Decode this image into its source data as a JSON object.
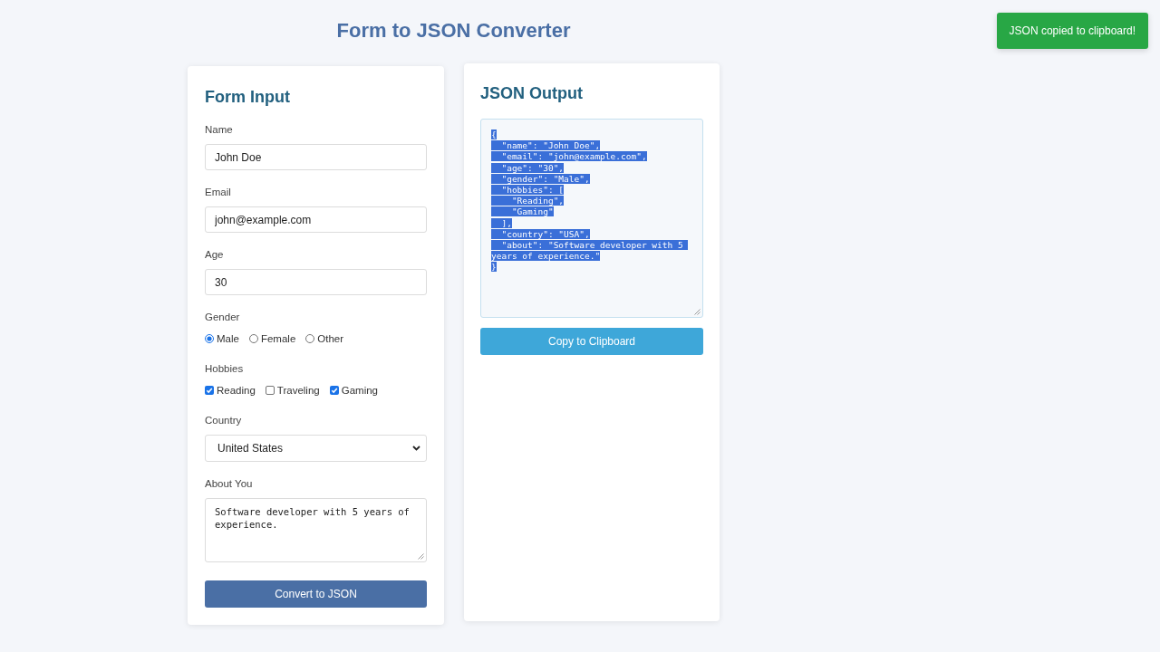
{
  "title": "Form to JSON Converter",
  "form": {
    "heading": "Form Input",
    "fields": [
      {
        "kind": "text",
        "label": "Name",
        "value": "John Doe"
      },
      {
        "kind": "text",
        "label": "Email",
        "value": "john@example.com"
      },
      {
        "kind": "text",
        "label": "Age",
        "value": "30"
      },
      {
        "kind": "radio",
        "label": "Gender",
        "options": [
          {
            "label": "Male",
            "selected": true
          },
          {
            "label": "Female",
            "selected": false
          },
          {
            "label": "Other",
            "selected": false
          }
        ]
      },
      {
        "kind": "checkbox",
        "label": "Hobbies",
        "options": [
          {
            "label": "Reading",
            "checked": true
          },
          {
            "label": "Traveling",
            "checked": false
          },
          {
            "label": "Gaming",
            "checked": true
          }
        ]
      },
      {
        "kind": "select",
        "label": "Country",
        "value": "United States"
      },
      {
        "kind": "textarea",
        "label": "About You",
        "value": "Software developer with 5 years of experience."
      }
    ],
    "submit_button": "Convert to JSON"
  },
  "output": {
    "heading": "JSON Output",
    "value": "{\n  \"name\": \"John Doe\",\n  \"email\": \"john@example.com\",\n  \"age\": \"30\",\n  \"gender\": \"Male\",\n  \"hobbies\": [\n    \"Reading\",\n    \"Gaming\"\n  ],\n  \"country\": \"USA\",\n  \"about\": \"Software developer with 5 years of experience.\"\n}",
    "text_selected": true,
    "copy_button": "Copy to Clipboard"
  },
  "toast": "JSON copied to clipboard!"
}
